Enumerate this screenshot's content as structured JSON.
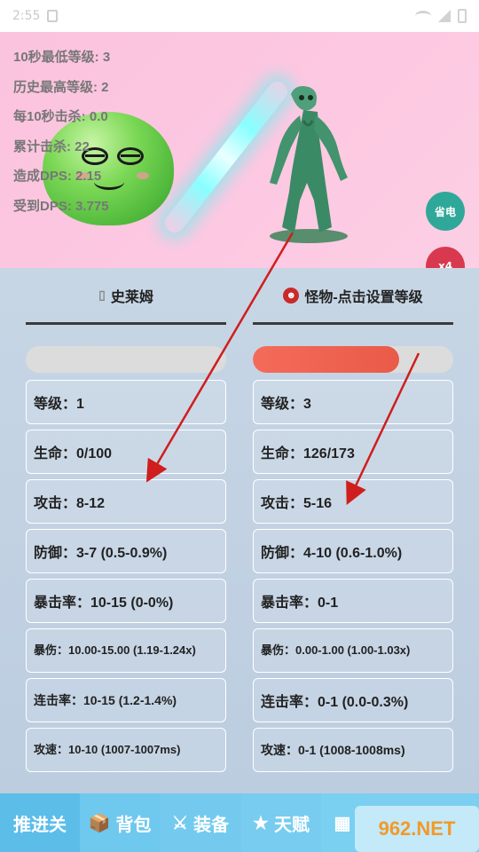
{
  "status_bar": {
    "time": "2:55"
  },
  "battle": {
    "stats": [
      "10秒最低等级: 3",
      "历史最高等级: 2",
      "每10秒击杀: 0.0",
      "累计击杀: 22",
      "造成DPS: 2.15",
      "受到DPS: 3.775"
    ],
    "save_button": "省电",
    "speed_button": "x4"
  },
  "player_column": {
    "title": "史莱姆",
    "icon": "slime-icon",
    "hp_fraction": 0.0,
    "cards": [
      "等级：1",
      "生命：0/100",
      "攻击：8-12",
      "防御：3-7 (0.5-0.9%)",
      "暴击率：10-15 (0-0%)",
      "暴伤：10.00-15.00 (1.19-1.24x)",
      "连击率：10-15 (1.2-1.4%)",
      "攻速：10-10 (1007-1007ms)"
    ]
  },
  "monster_column": {
    "title": "怪物-点击设置等级",
    "icon": "monster-face-icon",
    "hp_fraction": 0.73,
    "cards": [
      "等级：3",
      "生命：126/173",
      "攻击：5-16",
      "防御：4-10 (0.6-1.0%)",
      "暴击率：0-1",
      "暴伤：0.00-1.00 (1.00-1.03x)",
      "连击率：0-1 (0.0-0.3%)",
      "攻速：0-1 (1008-1008ms)"
    ]
  },
  "tabs": [
    {
      "label": "推进关",
      "icon": ""
    },
    {
      "label": "背包",
      "icon": "box-icon"
    },
    {
      "label": "装备",
      "icon": "swords-icon"
    },
    {
      "label": "天赋",
      "icon": "star-icon"
    },
    {
      "label": "",
      "icon": "building-icon"
    }
  ],
  "watermark": "962.NET",
  "colors": {
    "hp_fill": "#f0614f",
    "save_btn": "#2fa89a",
    "speed_btn": "#d8394f",
    "tabbar": "#7ccff0"
  }
}
